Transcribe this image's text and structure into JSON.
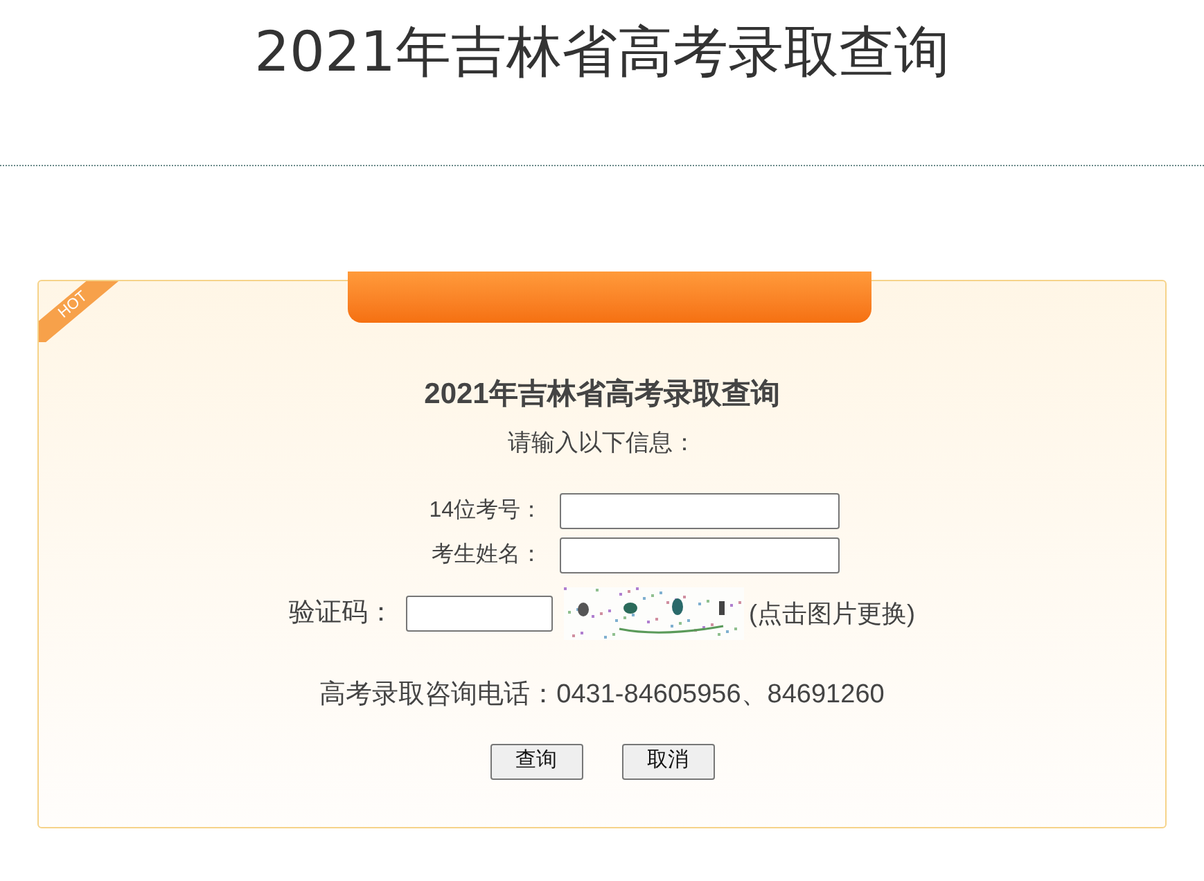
{
  "page_title": "2021年吉林省高考录取查询",
  "card": {
    "ribbon": "HOT",
    "title": "2021年吉林省高考录取查询",
    "subtitle": "请输入以下信息：",
    "fields": [
      {
        "label": "14位考号：",
        "kind": "wide"
      },
      {
        "label": "考生姓名：",
        "kind": "wide"
      },
      {
        "label": "验证码：",
        "kind": "captcha",
        "hint": "(点击图片更换)"
      }
    ],
    "phone": "高考录取咨询电话：0431-84605956、84691260",
    "buttons": [
      "查询",
      "取消"
    ]
  }
}
